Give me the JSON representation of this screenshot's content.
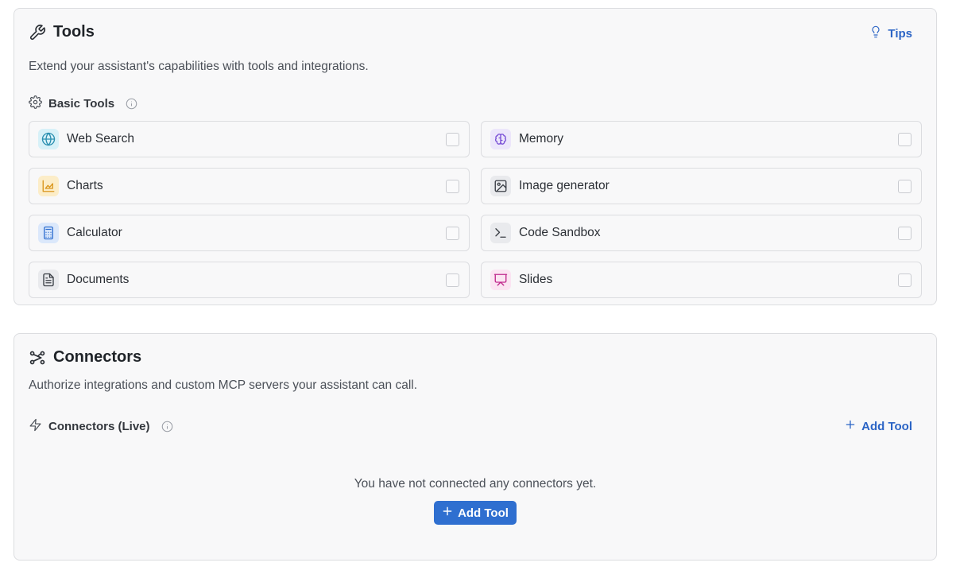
{
  "tools": {
    "title": "Tools",
    "tips_label": "Tips",
    "description": "Extend your assistant's capabilities with tools and integrations.",
    "section_label": "Basic Tools",
    "items": [
      {
        "label": "Web Search",
        "icon": "globe-icon",
        "bg": "#d7f1f8",
        "fg": "#2a8fb0"
      },
      {
        "label": "Memory",
        "icon": "brain-icon",
        "bg": "#ece6fb",
        "fg": "#7a50d6"
      },
      {
        "label": "Charts",
        "icon": "area-chart-icon",
        "bg": "#fcedc8",
        "fg": "#d9951c"
      },
      {
        "label": "Image generator",
        "icon": "image-icon",
        "bg": "#e9eaed",
        "fg": "#3a3e45"
      },
      {
        "label": "Calculator",
        "icon": "calculator-icon",
        "bg": "#dbe8fb",
        "fg": "#2f6fd0"
      },
      {
        "label": "Code Sandbox",
        "icon": "terminal-icon",
        "bg": "#e9eaed",
        "fg": "#3a3e45"
      },
      {
        "label": "Documents",
        "icon": "document-icon",
        "bg": "#e9eaed",
        "fg": "#3a3e45"
      },
      {
        "label": "Slides",
        "icon": "presentation-icon",
        "bg": "#fbe4f2",
        "fg": "#c0288d"
      }
    ]
  },
  "connectors": {
    "title": "Connectors",
    "description": "Authorize integrations and custom MCP servers your assistant can call.",
    "section_label": "Connectors (Live)",
    "add_tool_link": "Add Tool",
    "empty_text": "You have not connected any connectors yet.",
    "add_tool_button": "Add Tool"
  },
  "colors": {
    "accent": "#2b64c5",
    "button_bg": "#2f6fd0",
    "card_bg": "#f8f8f9",
    "border": "#dcdde0"
  }
}
